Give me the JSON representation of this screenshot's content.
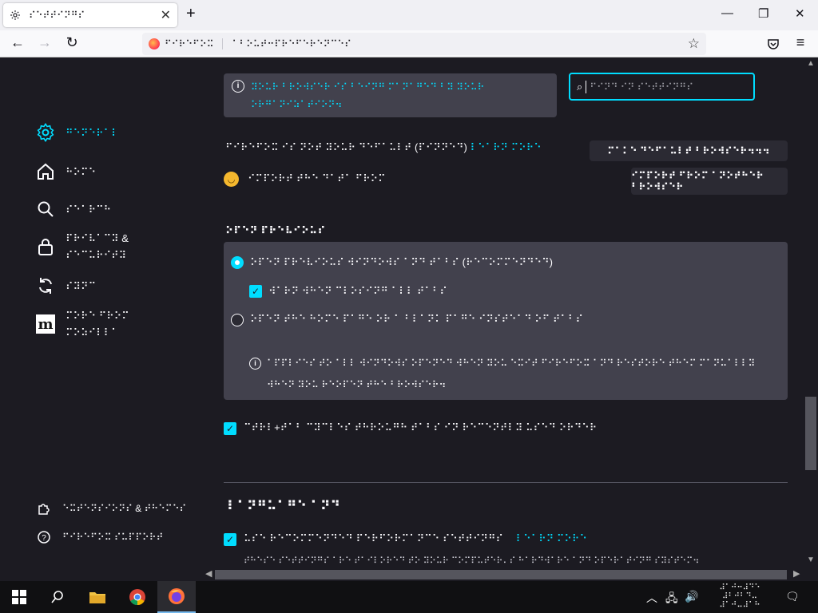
{
  "browser": {
    "tab_title": "⠎⠑⠞⠞⠊⠝⠛⠎",
    "url_identity": "⠋⠊⠗⠑⠋⠕⠭",
    "url": "⠁⠃⠕⠥⠞⠒⠏⠗⠑⠋⠑⠗⠑⠝⠉⠑⠎",
    "icons": [
      "gear-icon",
      "close-icon",
      "plus-icon",
      "back-icon",
      "forward-icon",
      "reload-icon",
      "star-icon",
      "pocket-icon",
      "menu-icon",
      "minimize-icon",
      "restore-icon",
      "window-close-icon"
    ]
  },
  "sidebar": {
    "items": [
      {
        "label": "⠛⠑⠝⠑⠗⠁⠇",
        "icon": "gear-icon",
        "active": true
      },
      {
        "label": "⠓⠕⠍⠑",
        "icon": "home-icon"
      },
      {
        "label": "⠎⠑⠁⠗⠉⠓",
        "icon": "search-icon"
      },
      {
        "label_line1": "⠏⠗⠊⠧⠁⠉⠽ &",
        "label_line2": "⠎⠑⠉⠥⠗⠊⠞⠽",
        "icon": "lock-icon"
      },
      {
        "label": "⠎⠽⠝⠉",
        "icon": "sync-icon"
      },
      {
        "label_line1": "⠍⠕⠗⠑ ⠋⠗⠕⠍",
        "label_line2": "⠍⠕⠵⠊⠇⠇⠁",
        "icon": "mozilla-icon"
      }
    ],
    "footer": [
      {
        "label": "⠑⠭⠞⠑⠝⠎⠊⠕⠝⠎ & ⠞⠓⠑⠍⠑⠎",
        "icon": "puzzle-icon"
      },
      {
        "label": "⠋⠊⠗⠑⠋⠕⠭ ⠎⠥⠏⠏⠕⠗⠞",
        "icon": "help-icon"
      }
    ]
  },
  "notice": {
    "line1": "⠽⠕⠥⠗ ⠃⠗⠕⠺⠎⠑⠗ ⠊⠎ ⠃⠑⠊⠝⠛ ⠍⠁⠝⠁⠛⠑⠙ ⠃⠽ ⠽⠕⠥⠗",
    "line2": "⠕⠗⠛⠁⠝⠊⠵⠁⠞⠊⠕⠝⠲"
  },
  "search": {
    "placeholder": "⠋⠊⠝⠙ ⠊⠝ ⠎⠑⠞⠞⠊⠝⠛⠎"
  },
  "startup": {
    "default_text": "⠋⠊⠗⠑⠋⠕⠭ ⠊⠎ ⠝⠕⠞ ⠽⠕⠥⠗ ⠙⠑⠋⠁⠥⠇⠞ (⠏⠊⠝⠝⠑⠙)",
    "link": "⠇⠑⠁⠗⠝ ⠍⠕⠗⠑",
    "make_default_button": "⠍⠁⠅⠑ ⠙⠑⠋⠁⠥⠇⠞ ⠃⠗⠕⠺⠎⠑⠗⠲⠲⠲",
    "import_text": "⠊⠍⠏⠕⠗⠞ ⠞⠓⠑ ⠙⠁⠞⠁ ⠋⠗⠕⠍",
    "import_button": "⠊⠍⠏⠕⠗⠞ ⠋⠗⠕⠍ ⠁⠝⠕⠞⠓⠑⠗ ⠃⠗⠕⠺⠎⠑⠗"
  },
  "tabs_section": {
    "heading": "⠕⠏⠑⠝ ⠏⠗⠑⠧⠊⠕⠥⠎",
    "option1": "⠕⠏⠑⠝ ⠏⠗⠑⠧⠊⠕⠥⠎ ⠺⠊⠝⠙⠕⠺⠎ ⠁⠝⠙ ⠞⠁⠃⠎ (⠗⠑⠉⠕⠍⠍⠑⠝⠙⠑⠙)",
    "option1_sub": "⠺⠁⠗⠝ ⠺⠓⠑⠝ ⠉⠇⠕⠎⠊⠝⠛ ⠁⠇⠇ ⠞⠁⠃⠎",
    "option2": "⠕⠏⠑⠝ ⠞⠓⠑ ⠓⠕⠍⠑ ⠏⠁⠛⠑ ⠕⠗ ⠁ ⠃⠇⠁⠝⠅ ⠏⠁⠛⠑ ⠊⠝⠎⠞⠑⠁⠙ ⠕⠋ ⠞⠁⠃⠎",
    "info_line1": "⠁⠏⠏⠇⠊⠑⠎ ⠞⠕ ⠁⠇⠇ ⠺⠊⠝⠙⠕⠺⠎ ⠕⠏⠑⠝⠑⠙ ⠺⠓⠑⠝ ⠽⠕⠥ ⠑⠭⠊⠞ ⠋⠊⠗⠑⠋⠕⠭ ⠁⠝⠙ ⠗⠑⠎⠞⠕⠗⠑ ⠞⠓⠑⠍ ⠍⠁⠝⠥⠁⠇⠇⠽",
    "info_line2": "⠺⠓⠑⠝ ⠽⠕⠥ ⠗⠑⠕⠏⠑⠝ ⠞⠓⠑ ⠃⠗⠕⠺⠎⠑⠗⠲"
  },
  "ctrl_tab": {
    "label": "⠉⠞⠗⠇+⠞⠁⠃ ⠉⠽⠉⠇⠑⠎ ⠞⠓⠗⠕⠥⠛⠓ ⠞⠁⠃⠎ ⠊⠝ ⠗⠑⠉⠑⠝⠞⠇⠽ ⠥⠎⠑⠙ ⠕⠗⠙⠑⠗"
  },
  "lower_section": {
    "heading": "⠇⠁⠝⠛⠥⠁⠛⠑ ⠁⠝⠙",
    "check_label": "⠥⠎⠑ ⠗⠑⠉⠕⠍⠍⠑⠝⠙⠑⠙ ⠏⠑⠗⠋⠕⠗⠍⠁⠝⠉⠑ ⠎⠑⠞⠞⠊⠝⠛⠎",
    "check_link": "⠇⠑⠁⠗⠝ ⠍⠕⠗⠑",
    "desc": "⠞⠓⠑⠎⠑ ⠎⠑⠞⠞⠊⠝⠛⠎ ⠁⠗⠑ ⠞⠁⠊⠇⠕⠗⠑⠙ ⠞⠕ ⠽⠕⠥⠗ ⠉⠕⠍⠏⠥⠞⠑⠗⠄⠎ ⠓⠁⠗⠙⠺⠁⠗⠑ ⠁⠝⠙ ⠕⠏⠑⠗⠁⠞⠊⠝⠛ ⠎⠽⠎⠞⠑⠍⠲"
  },
  "taskbar": {
    "apps": [
      "windows-start-icon",
      "search-icon",
      "file-explorer-icon",
      "chrome-icon",
      "firefox-icon"
    ],
    "clock_line1": "⠼⠁⠚⠒⠼⠙⠑",
    "clock_line2": "⠼⠃⠚⠃⠙⠤",
    "clock_line3": "⠼⠁⠚⠤⠼⠁⠓"
  },
  "colors": {
    "accent": "#00ddff",
    "background": "#1c1b22",
    "panel": "#42414d",
    "button": "#2b2a33"
  }
}
